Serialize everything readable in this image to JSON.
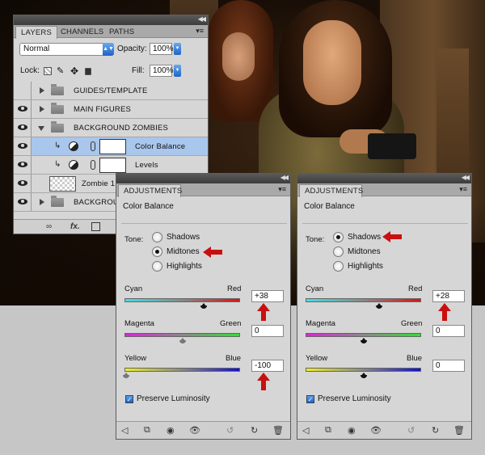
{
  "layers_panel": {
    "tabs": [
      "LAYERS",
      "CHANNELS",
      "PATHS"
    ],
    "blend_mode": "Normal",
    "opacity_label": "Opacity:",
    "opacity_value": "100%",
    "lock_label": "Lock:",
    "fill_label": "Fill:",
    "fill_value": "100%",
    "layers": [
      {
        "name": "GUIDES/TEMPLATE",
        "type": "group",
        "visible": false,
        "expanded": false
      },
      {
        "name": "MAIN FIGURES",
        "type": "group",
        "visible": true,
        "expanded": false
      },
      {
        "name": "BACKGROUND ZOMBIES",
        "type": "group",
        "visible": true,
        "expanded": true
      },
      {
        "name": "Color Balance",
        "type": "adjustment",
        "visible": true,
        "selected": true
      },
      {
        "name": "Levels",
        "type": "adjustment",
        "visible": true,
        "selected": false
      },
      {
        "name": "Zombie 1",
        "type": "pixel",
        "visible": true
      },
      {
        "name": "BACKGROUND",
        "type": "group",
        "visible": true,
        "expanded": false
      }
    ]
  },
  "adjustments_left": {
    "tab": "ADJUSTMENTS",
    "heading": "Color Balance",
    "tone_label": "Tone:",
    "tones": [
      "Shadows",
      "Midtones",
      "Highlights"
    ],
    "selected_tone": "Midtones",
    "sliders": [
      {
        "left": "Cyan",
        "right": "Red",
        "value": "+38"
      },
      {
        "left": "Magenta",
        "right": "Green",
        "value": "0"
      },
      {
        "left": "Yellow",
        "right": "Blue",
        "value": "-100"
      }
    ],
    "preserve_luminosity": "Preserve Luminosity",
    "preserve_checked": true
  },
  "adjustments_right": {
    "tab": "ADJUSTMENTS",
    "heading": "Color Balance",
    "tone_label": "Tone:",
    "tones": [
      "Shadows",
      "Midtones",
      "Highlights"
    ],
    "selected_tone": "Shadows",
    "sliders": [
      {
        "left": "Cyan",
        "right": "Red",
        "value": "+28"
      },
      {
        "left": "Magenta",
        "right": "Green",
        "value": "0"
      },
      {
        "left": "Yellow",
        "right": "Blue",
        "value": "0"
      }
    ],
    "preserve_luminosity": "Preserve Luminosity",
    "preserve_checked": true
  },
  "colors": {
    "panel_bg": "#d6d6d6",
    "selected_row": "#a9c6ec",
    "annotation_arrow": "#c81010",
    "cyan_red_gradient": [
      "#3fe0e8",
      "#e01010"
    ],
    "magenta_green_gradient": [
      "#e020e0",
      "#30e030"
    ],
    "yellow_blue_gradient": [
      "#f0f020",
      "#1010d0"
    ]
  },
  "icons": [
    "eye-icon",
    "folder-icon",
    "adjustment-layer-icon",
    "link-icon",
    "clip-icon",
    "return-arrow-icon",
    "clip-to-layer-icon",
    "visibility-icon",
    "view-previous-icon",
    "reset-icon",
    "trash-icon",
    "link-layers-icon",
    "fx-icon",
    "add-mask-icon"
  ]
}
